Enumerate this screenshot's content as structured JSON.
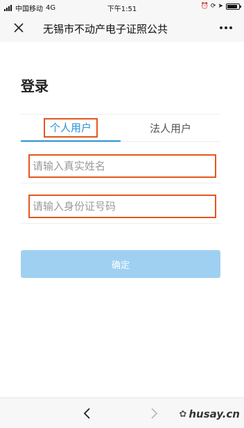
{
  "status_bar": {
    "carrier": "中国移动",
    "network": "4G",
    "time": "下午1:51",
    "battery_level": 0.9
  },
  "nav": {
    "title": "无锡市不动产电子证照公共",
    "close_icon": "close-icon",
    "more_icon": "more-dots-icon"
  },
  "page": {
    "heading": "登录"
  },
  "tabs": {
    "personal": "个人用户",
    "legal": "法人用户",
    "active_color": "#2b93d4"
  },
  "form": {
    "name_placeholder": "请输入真实姓名",
    "id_placeholder": "请输入身份证号码",
    "name_value": "",
    "id_value": "",
    "highlight_color": "#e4561e"
  },
  "buttons": {
    "confirm_label": "确定",
    "confirm_color": "#9fd0f2"
  },
  "toolbar": {
    "back_icon": "chevron-left-icon",
    "forward_icon": "chevron-right-icon"
  },
  "watermark": {
    "text": "husay.cn"
  }
}
